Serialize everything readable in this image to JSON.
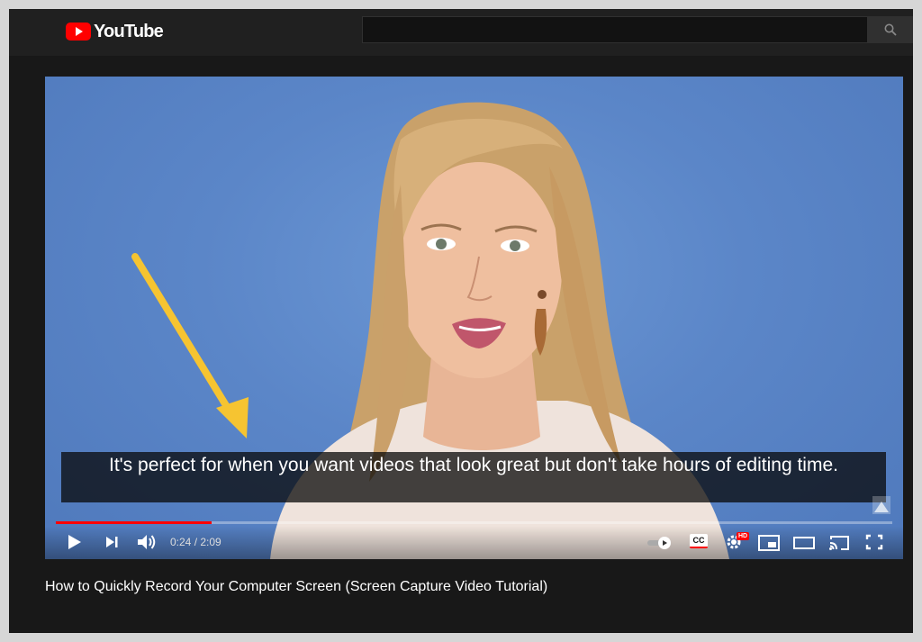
{
  "masthead": {
    "logo_text": "YouTube",
    "search_placeholder": ""
  },
  "player": {
    "caption": "It's perfect for when you want videos that look great but don't take hours of editing time.",
    "current_time": "0:24",
    "separator": " / ",
    "duration": "2:09",
    "progress_fraction": 0.186,
    "icons": [
      "play-icon",
      "next-icon",
      "volume-icon",
      "autoplay-toggle-icon",
      "captions-icon",
      "settings-icon",
      "miniplayer-icon",
      "theater-mode-icon",
      "cast-icon",
      "fullscreen-icon"
    ],
    "settings_badge": "HD",
    "captions_label": "CC"
  },
  "video": {
    "title": "How to Quickly Record Your Computer Screen (Screen Capture Video Tutorial)"
  },
  "colors": {
    "accent": "#ff0000",
    "background": "#181818",
    "video_backdrop": "#5b86c8",
    "arrow": "#f6c431"
  }
}
